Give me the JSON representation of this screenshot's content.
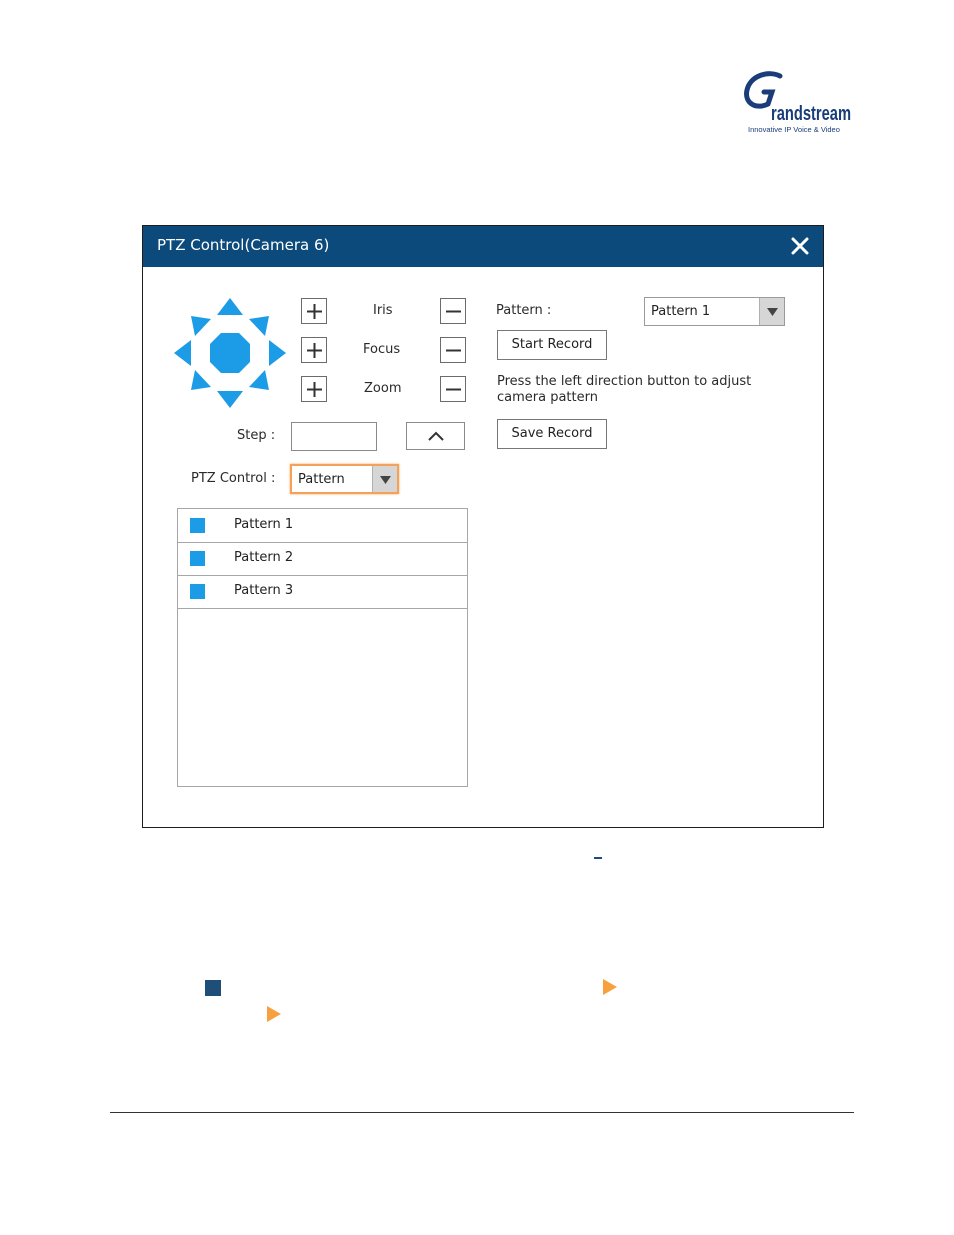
{
  "logo": {
    "brand": "Grandstream",
    "tagline": "Innovative IP Voice & Video"
  },
  "dialog": {
    "title": "PTZ Control(Camera 6)",
    "close_icon": "close-icon",
    "adjust": {
      "iris_label": "Iris",
      "focus_label": "Focus",
      "zoom_label": "Zoom"
    },
    "step_label": "Step :",
    "step_value": "",
    "ptz_control_label": "PTZ Control :",
    "ptz_control_value": "Pattern",
    "pattern_label": "Pattern :",
    "pattern_value": "Pattern 1",
    "start_record_label": "Start Record",
    "save_record_label": "Save Record",
    "message": "Press the left direction button to adjust camera pattern",
    "patterns": [
      {
        "label": "Pattern 1"
      },
      {
        "label": "Pattern 2"
      },
      {
        "label": "Pattern 3"
      }
    ]
  },
  "colors": {
    "titlebar": "#0c4a7c",
    "dpad": "#1c9be6",
    "checkbox": "#1c9be6",
    "focus_ring": "#f4a25a",
    "play_icon": "#f7a040",
    "stop_icon": "#1f4e79"
  }
}
